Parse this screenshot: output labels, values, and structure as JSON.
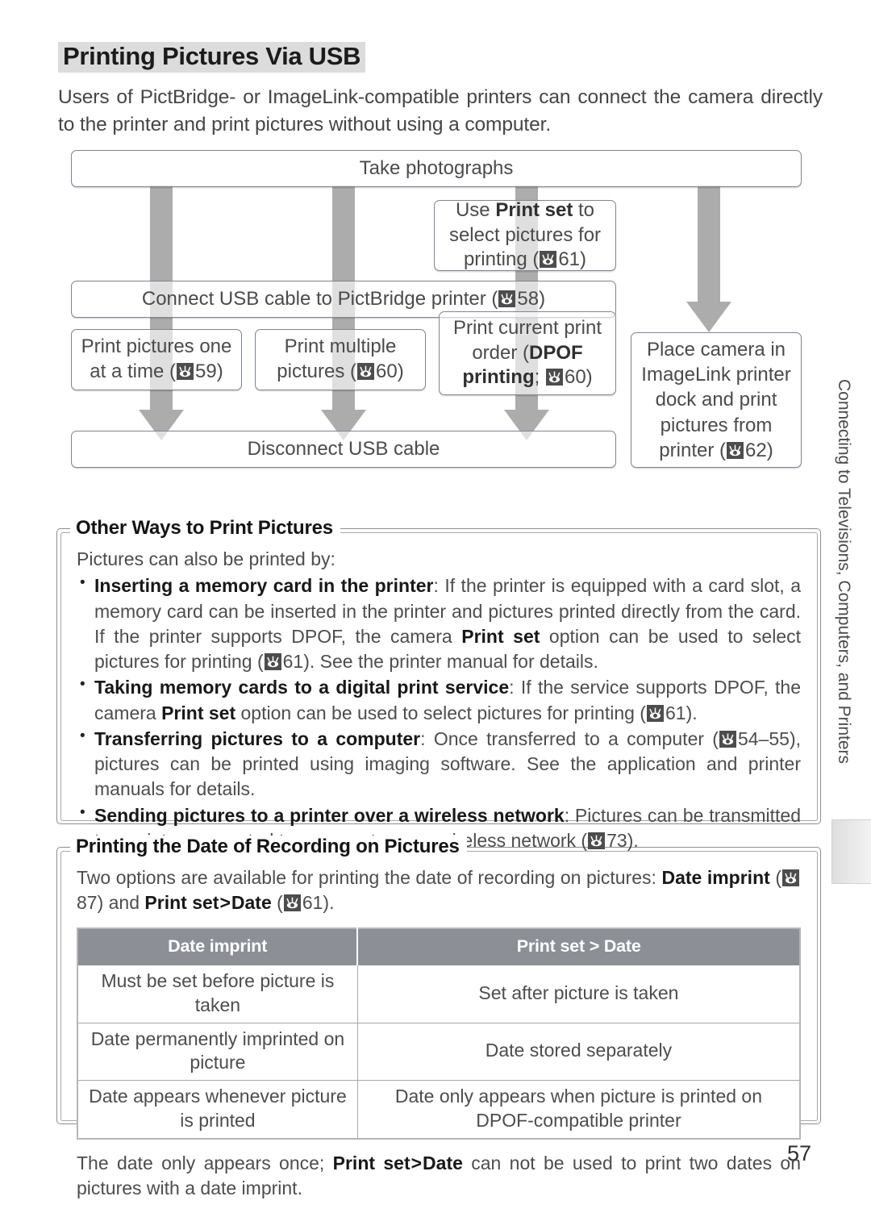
{
  "page": {
    "title": "Printing Pictures Via USB",
    "intro": "Users of PictBridge- or ImageLink-compatible printers can connect the camera directly to the printer and print pictures without using a computer.",
    "folio": "57",
    "side_tab": "Connecting to Televisions, Computers, and Printers"
  },
  "flowchart": {
    "boxes": {
      "take_photographs": "Take photographs",
      "use_print_set_pre": "Use ",
      "use_print_set_bold": "Print set",
      "use_print_set_post": " to select pictures for printing (",
      "use_print_set_page": "61",
      "connect_usb_pre": "Connect USB cable to PictBridge printer (",
      "connect_usb_page": "58",
      "print_one_pre": "Print pictures one at a time (",
      "print_one_page": "59",
      "print_multiple_pre": "Print multiple pictures (",
      "print_multiple_page": "60",
      "dpof_pre": "Print current print order (",
      "dpof_bold1": "DPOF printing",
      "dpof_mid": "; ",
      "dpof_page": "60",
      "disconnect_usb": "Disconnect USB cable",
      "imagelink_pre": "Place camera in ImageLink printer dock and print pictures from printer (",
      "imagelink_page": "62"
    }
  },
  "note_other_ways": {
    "title": "Other Ways to Print Pictures",
    "lead": "Pictures can also be printed by:",
    "bullets": [
      {
        "bold": "Inserting a memory card in the printer",
        "text_a": ": If the printer is equipped with a card slot, a memory card can be inserted in the printer and pictures printed directly from the card.  If the printer supports DPOF, the camera ",
        "bold2": "Print set",
        "text_b": " option can be used to select pictures for printing (",
        "page": "61",
        "text_c": ").  See the printer manual for details."
      },
      {
        "bold": "Taking memory cards to a digital print service",
        "text_a": ": If the service supports DPOF, the camera ",
        "bold2": "Print set",
        "text_b": " option can be used to select pictures for printing (",
        "page": "61",
        "text_c": ")."
      },
      {
        "bold": "Transferring pictures to a computer",
        "text_a": ": Once transferred to a computer (",
        "page": "54–55",
        "text_c": "), pictures can be printed using imaging software.  See the application and printer manuals for details."
      },
      {
        "bold": "Sending pictures to a printer over a wireless network",
        "text_a": ": Pictures can be transmitted to a printer connected to a computer on a wireless network (",
        "page": "73",
        "text_c": ")."
      }
    ]
  },
  "note_date": {
    "title": "Printing the Date of Recording on Pictures",
    "lead_a": "Two options are available for printing the date of recording on pictures: ",
    "lead_bold1": "Date imprint",
    "lead_b": " (",
    "lead_page1": "87",
    "lead_c": ") and ",
    "lead_bold2": "Print set",
    "lead_gt": ">",
    "lead_bold3": "Date",
    "lead_d": " (",
    "lead_page2": "61",
    "lead_e": ").",
    "table": {
      "headers": [
        "Date imprint",
        "Print set > Date"
      ],
      "rows": [
        [
          "Must be set before picture is taken",
          "Set after picture is taken"
        ],
        [
          "Date permanently imprinted on picture",
          "Date stored separately"
        ],
        [
          "Date appears whenever picture is printed",
          "Date only appears when picture is printed on DPOF-compatible printer"
        ]
      ]
    },
    "footnote_a": "The date only appears once; ",
    "footnote_bold1": "Print set",
    "footnote_gt": ">",
    "footnote_bold2": "Date",
    "footnote_b": " can not be used to print two dates on pictures with a date imprint."
  },
  "icons": {
    "page_ref": "page-reference-eye-icon"
  }
}
